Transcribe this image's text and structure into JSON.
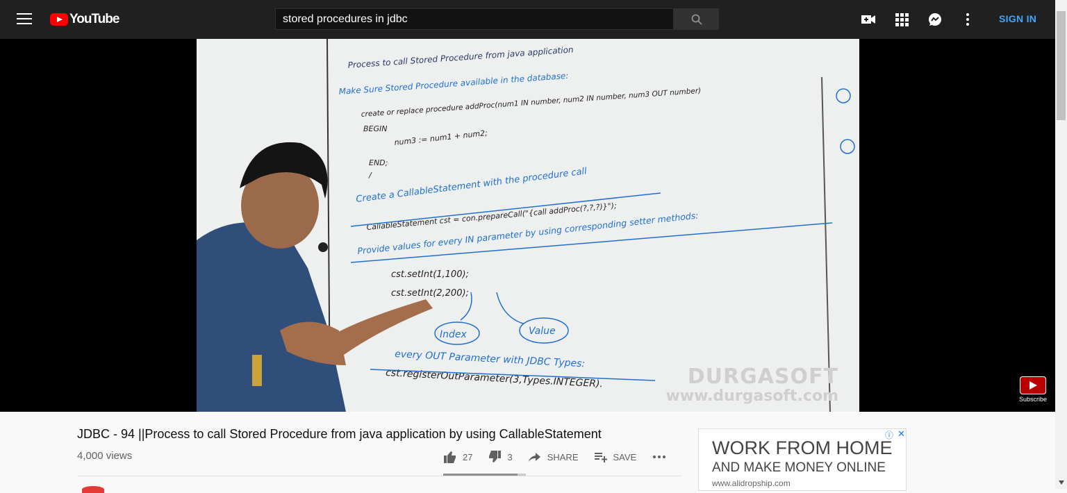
{
  "masthead": {
    "logo_text": "YouTube",
    "search_value": "stored procedures in jdbc",
    "sign_in": "SIGN IN"
  },
  "video": {
    "board_lines": [
      "Process to call Stored Procedure from java application",
      "Make Sure Stored Procedure available in the database:",
      "create or replace procedure addProc(num1 IN number, num2 IN number, num3 OUT number)",
      "BEGIN",
      "num3 := num1 + num2;",
      "END;",
      "/",
      "Create a CallableStatement with the procedure call",
      "CallableStatement cst = con.prepareCall(\"{call addProc(?,?,?)}\");",
      "Provide values for every IN parameter by using corresponding setter methods:",
      "cst.setInt(1,100);",
      "cst.setInt(2,200);",
      "Index",
      "Value",
      "every OUT Parameter with JDBC Types:",
      "cst.registerOutParameter(3,Types.INTEGER)."
    ],
    "watermark_line1": "DURGASOFT",
    "watermark_line2": "www.durgasoft.com",
    "subscribe_label": "Subscribe"
  },
  "info": {
    "title": "JDBC - 94 ||Process to call Stored Procedure from java application by using CallableStatement",
    "views": "4,000 views",
    "likes": "27",
    "dislikes": "3",
    "share": "SHARE",
    "save": "SAVE",
    "like_ratio": 0.9
  },
  "ad": {
    "headline1": "WORK FROM HOME",
    "headline2": "AND MAKE MONEY ONLINE",
    "url": "www.alidropship.com",
    "info_icon": "ⓘ",
    "close_icon": "✕"
  }
}
